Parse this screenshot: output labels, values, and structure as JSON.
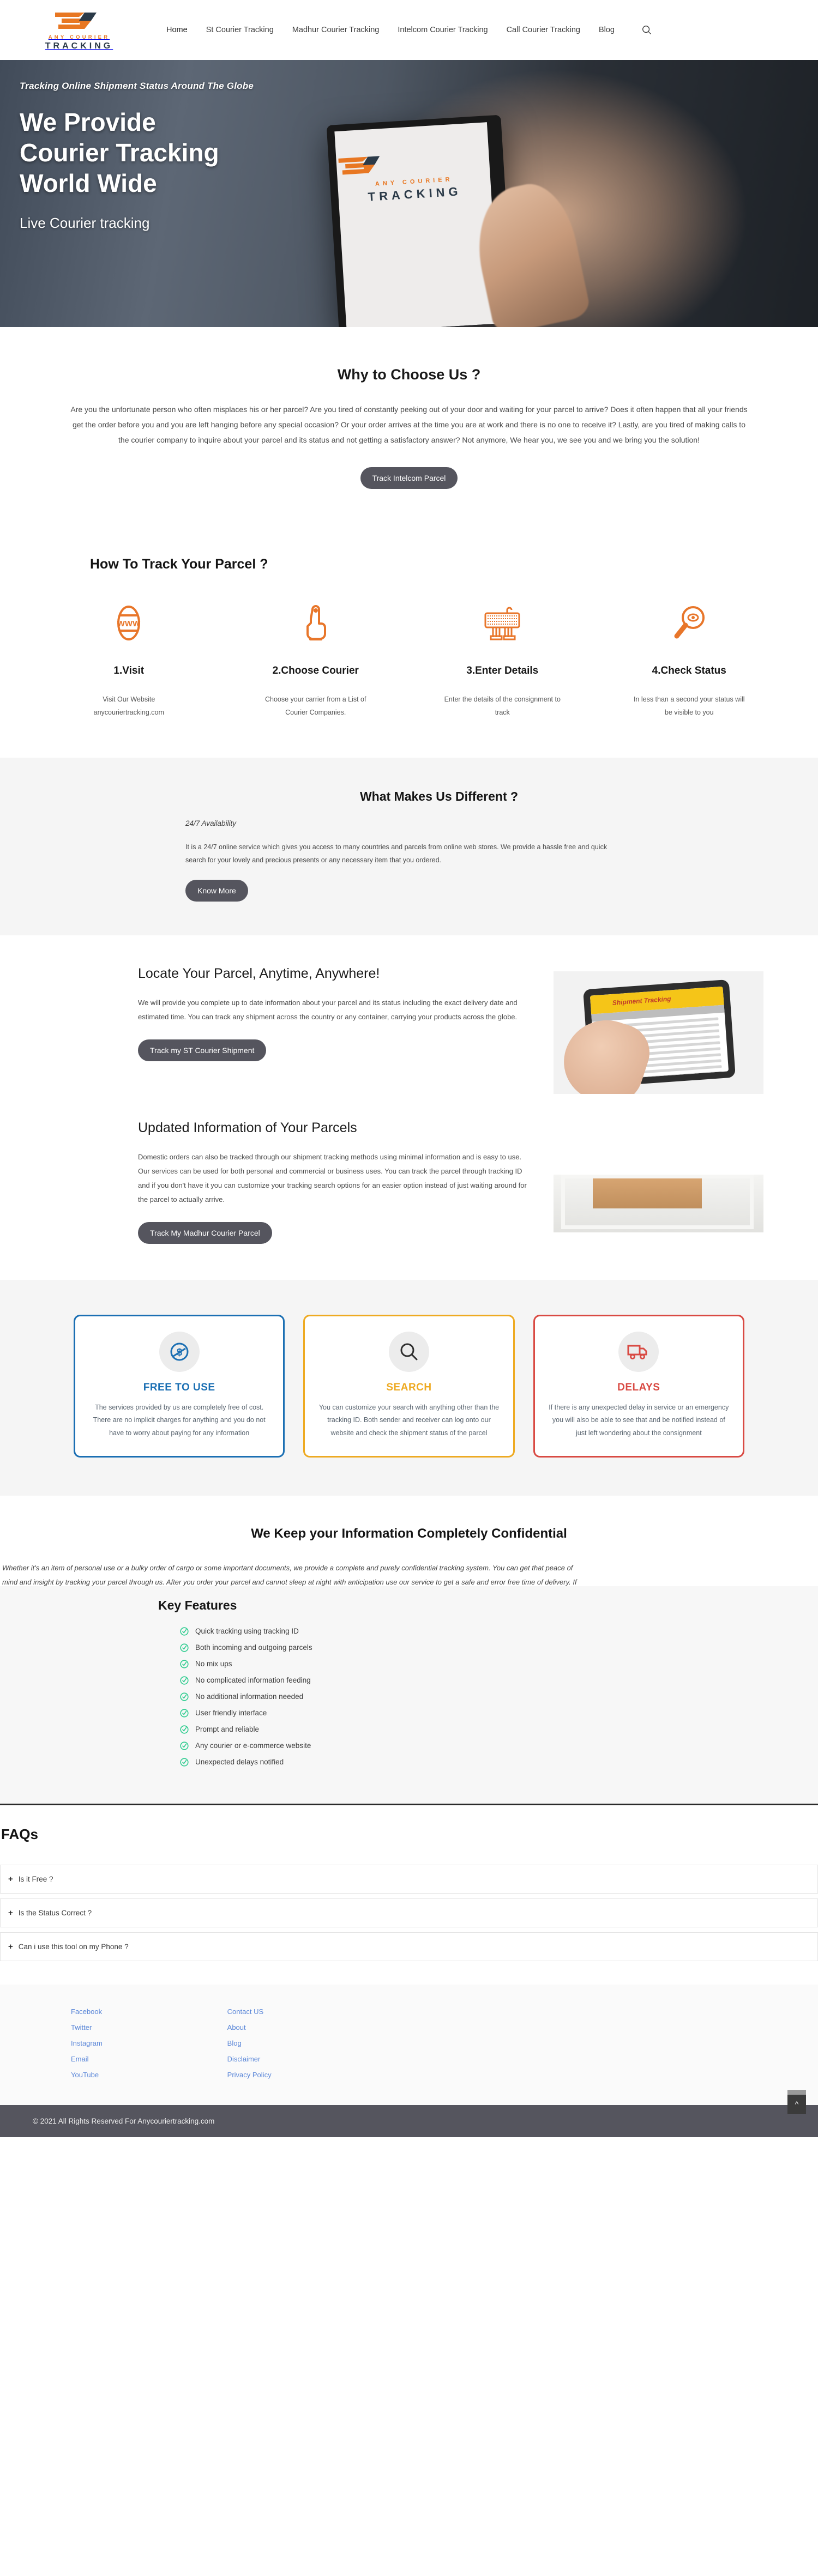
{
  "brand": {
    "name_top": "ANY COURIER",
    "name_bottom": "TRACKING",
    "accent_orange": "#E87722",
    "accent_dark": "#2b3a48"
  },
  "nav": {
    "items": [
      {
        "label": "Home",
        "active": true
      },
      {
        "label": "St Courier Tracking",
        "active": false
      },
      {
        "label": "Madhur Courier Tracking",
        "active": false
      },
      {
        "label": "Intelcom Courier Tracking",
        "active": false
      },
      {
        "label": "Call Courier Tracking",
        "active": false
      },
      {
        "label": "Blog",
        "active": false
      }
    ],
    "search_icon": "search-icon"
  },
  "hero": {
    "kicker": "Tracking Online Shipment Status Around The Globe",
    "title_line1": "We Provide",
    "title_line2": "Courier Tracking",
    "title_line3": "World Wide",
    "subtitle": "Live Courier tracking"
  },
  "why": {
    "title": "Why to Choose Us ?",
    "body": "Are you the unfortunate person who often misplaces his or her parcel? Are you tired of constantly peeking out of your door and waiting for your parcel to arrive? Does it often happen that all your friends get the order before you and you are left hanging before any special occasion? Or your order arrives at the time you are at work and there is no one to receive it? Lastly, are you tired of making calls to the courier company to inquire about your parcel and its status and not getting a satisfactory answer? Not anymore, We hear you, we see you and we bring you the solution!",
    "button": "Track Intelcom Parcel"
  },
  "how": {
    "title": "How To Track Your Parcel ?",
    "steps": [
      {
        "icon": "globe-www-icon",
        "name": "1.Visit",
        "desc": "Visit Our Website anycouriertracking.com"
      },
      {
        "icon": "pointing-hand-icon",
        "name": "2.Choose Courier",
        "desc": "Choose your carrier from a List of Courier Companies."
      },
      {
        "icon": "keyboard-typing-icon",
        "name": "3.Enter Details",
        "desc": "Enter the details of the consignment to track"
      },
      {
        "icon": "magnifier-eye-icon",
        "name": "4.Check Status",
        "desc": "In less than a second your status will be visible to you"
      }
    ]
  },
  "different": {
    "title": "What Makes Us Different ?",
    "subtitle": "24/7 Availability",
    "body": "It is a 24/7 online service which gives you access to many countries and parcels from online web stores. We provide a hassle free and quick search for your lovely and precious presents or any necessary item that you ordered.",
    "button": "Know More"
  },
  "locate": {
    "title": "Locate Your Parcel, Anytime, Anywhere!",
    "body": "We will provide you complete up to date information about your parcel and its status including the exact delivery date and estimated time. You can track any shipment across the country or any container, carrying your products across the globe.",
    "button": "Track my ST Courier Shipment",
    "image_alt": "hands-holding-tablet-shipment-tracking",
    "image_screen_label": "Shipment Tracking"
  },
  "updated": {
    "title": "Updated Information of Your Parcels",
    "body": " Domestic orders can also be tracked through our shipment tracking methods using minimal information and is easy to use. Our services can be used for both personal and commercial or business uses. You can track the parcel through tracking ID and if you don't have it you can customize your tracking search options for an easier option instead of just waiting around for the parcel to actually arrive.",
    "button": "Track My Madhur Courier Parcel",
    "image_alt": "cardboard-parcel-on-table"
  },
  "cards": [
    {
      "icon": "no-money-icon",
      "color": "#1b6fb3",
      "title": "FREE TO USE",
      "body": "The services provided by us are completely free of cost. There are no implicit charges for anything and you do not have to worry about paying for any information"
    },
    {
      "icon": "magnifier-icon",
      "color": "#eeaa22",
      "title": "SEARCH",
      "body": "You can customize your search with anything other than the tracking ID. Both sender and receiver can log onto our website and check the shipment status of the parcel"
    },
    {
      "icon": "delivery-truck-icon",
      "color": "#d94a43",
      "title": "DELAYS",
      "body": "If there is any unexpected delay in service or an emergency you will also be able to see that and be notified instead of just left wondering about the consignment"
    }
  ],
  "confidential": {
    "title": "We Keep your Information Completely Confidential",
    "line1": "Whether it's an item of personal use or a bulky order of cargo or some important documents, we provide a complete and purely confidential tracking system. You can get that peace of",
    "line2": "mind and insight by tracking your parcel through us. After you order your parcel and cannot sleep at night with anticipation use our service to get a safe and error free time of delivery. If"
  },
  "key_features": {
    "title": "Key Features",
    "check_icon": "check-circle-icon",
    "items": [
      "Quick tracking using tracking ID",
      "Both incoming and outgoing parcels",
      "No mix ups",
      "No complicated information feeding",
      "No additional information needed",
      "User friendly interface",
      "Prompt and reliable",
      "Any courier or e-commerce website",
      "Unexpected delays notified"
    ]
  },
  "faqs": {
    "title": "FAQs",
    "expand_icon": "plus-icon",
    "items": [
      {
        "question": "Is it Free ?"
      },
      {
        "question": "Is the Status Correct ?"
      },
      {
        "question": "Can i use this tool on my Phone ?"
      }
    ]
  },
  "footer": {
    "social": [
      {
        "label": "Facebook"
      },
      {
        "label": "Twitter"
      },
      {
        "label": "Instagram"
      },
      {
        "label": "Email"
      },
      {
        "label": "YouTube"
      }
    ],
    "pages": [
      {
        "label": "Contact US"
      },
      {
        "label": "About"
      },
      {
        "label": "Blog"
      },
      {
        "label": "Disclaimer"
      },
      {
        "label": "Privacy Policy"
      }
    ],
    "copyright": "© 2021 All Rights Reserved For Anycouriertracking.com",
    "to_top_icon": "chevron-up-icon"
  }
}
